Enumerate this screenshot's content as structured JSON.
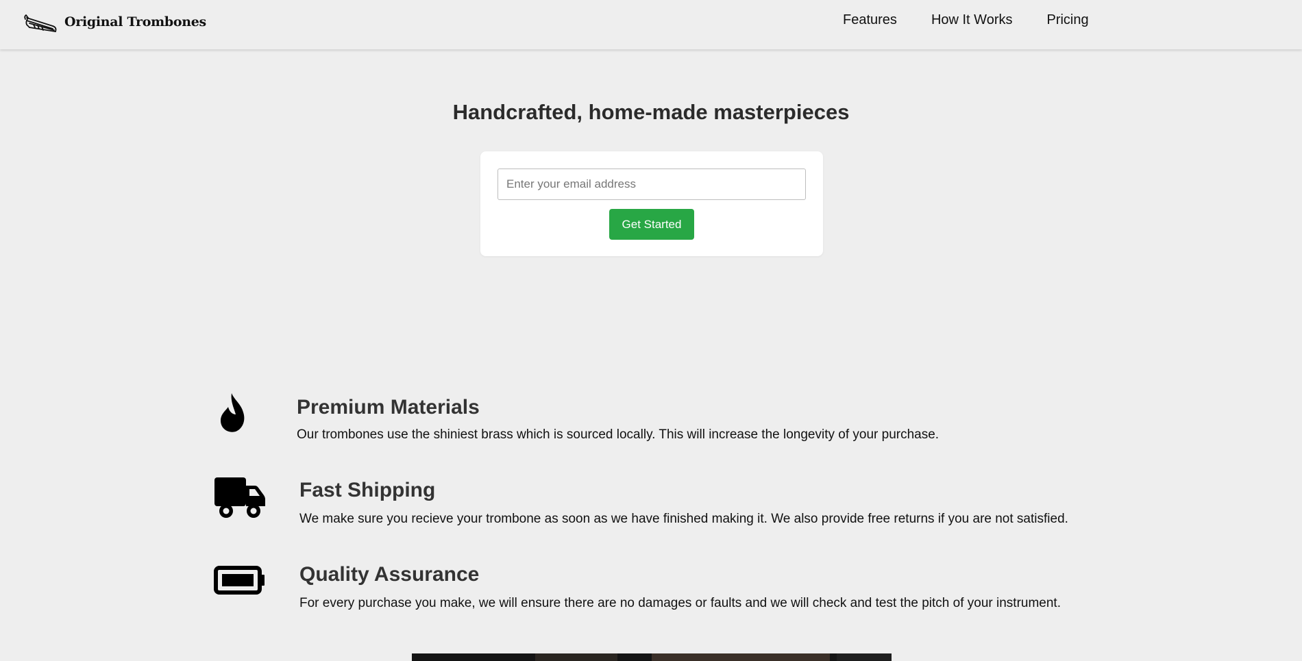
{
  "header": {
    "logo_icon": "trombone-icon",
    "brand": "Original Trombones",
    "nav": [
      {
        "label": "Features"
      },
      {
        "label": "How It Works"
      },
      {
        "label": "Pricing"
      }
    ]
  },
  "hero": {
    "title": "Handcrafted, home-made masterpieces",
    "email_placeholder": "Enter your email address",
    "email_value": "",
    "submit_label": "Get Started",
    "submit_color": "#28a745"
  },
  "features": [
    {
      "icon": "fire-icon",
      "title": "Premium Materials",
      "description": "Our trombones use the shiniest brass which is sourced locally. This will increase the longevity of your purchase."
    },
    {
      "icon": "truck-icon",
      "title": "Fast Shipping",
      "description": "We make sure you recieve your trombone as soon as we have finished making it. We also provide free returns if you are not satisfied."
    },
    {
      "icon": "battery-icon",
      "title": "Quality Assurance",
      "description": "For every purchase you make, we will ensure there are no damages or faults and we will check and test the pitch of your instrument."
    }
  ],
  "colors": {
    "background": "#eeeeee",
    "accent": "#28a745"
  }
}
